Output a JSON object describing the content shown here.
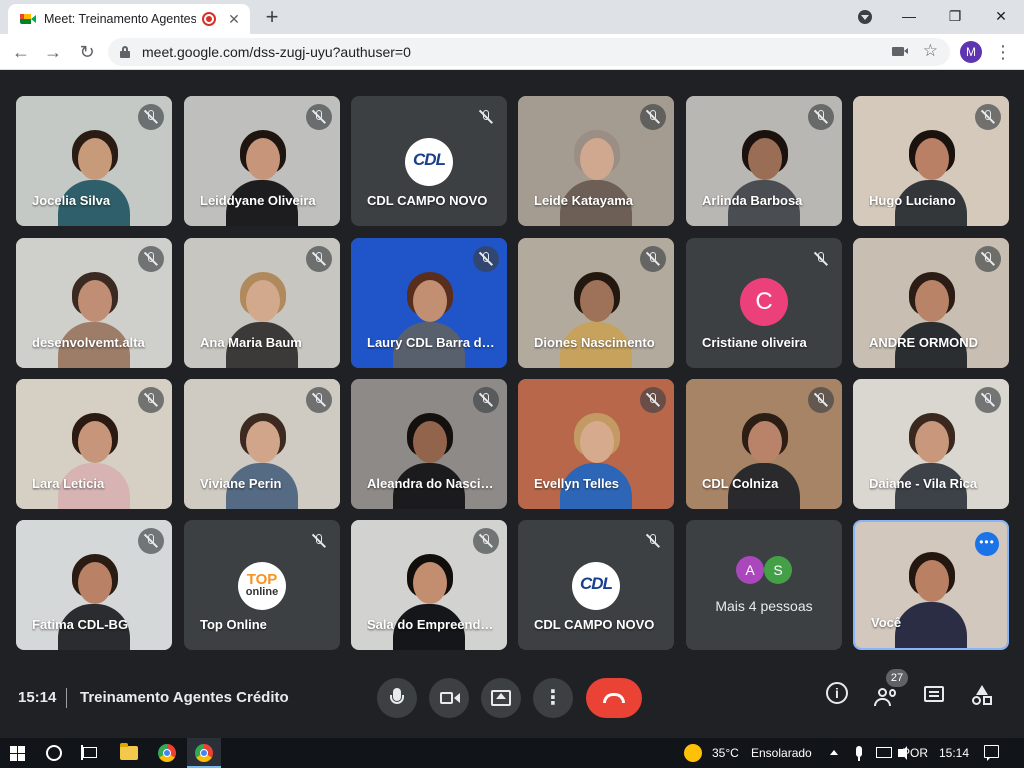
{
  "browser": {
    "tab_title": "Meet: Treinamento Agentes Crédito",
    "tab_close": "✕",
    "new_tab": "+",
    "minimize": "—",
    "maximize": "❐",
    "close": "✕",
    "back": "←",
    "forward": "→",
    "reload": "↻",
    "url": "meet.google.com/dss-zugj-uyu?authuser=0",
    "star": "☆",
    "profile_initial": "M",
    "menu": "⋮"
  },
  "tiles": [
    {
      "name": "Jocelia Silva",
      "kind": "video",
      "skin": "#c79a7a",
      "hair": "#2a1c14",
      "shirt": "#2e5f6a",
      "bg": "#c4c9c6"
    },
    {
      "name": "Leiddyane Oliveira",
      "kind": "video",
      "skin": "#c7957a",
      "hair": "#1e1410",
      "shirt": "#1d1d1f",
      "bg": "#bfc0bd"
    },
    {
      "name": "CDL CAMPO NOVO",
      "kind": "logo-cdl",
      "logo_text": "CDL"
    },
    {
      "name": "Leide Katayama",
      "kind": "video",
      "skin": "#d0a88f",
      "hair": "#9b8e84",
      "shirt": "#6d5f56",
      "bg": "#a49c90"
    },
    {
      "name": "Arlinda Barbosa",
      "kind": "video",
      "skin": "#9a6e55",
      "hair": "#1b120e",
      "shirt": "#4a4e52",
      "bg": "#b9b7b3"
    },
    {
      "name": "Hugo Luciano",
      "kind": "video",
      "skin": "#b98066",
      "hair": "#1a120d",
      "shirt": "#33373a",
      "bg": "#d4c9bb"
    },
    {
      "name": "desenvolvemt.alta",
      "kind": "video",
      "skin": "#c08e74",
      "hair": "#3a2a22",
      "shirt": "#9d7c68",
      "bg": "#cfd0cb"
    },
    {
      "name": "Ana Maria Baum",
      "kind": "video",
      "skin": "#d2a98c",
      "hair": "#b08a5c",
      "shirt": "#3c3a38",
      "bg": "#c8c6c0"
    },
    {
      "name": "Laury CDL Barra do Bugres",
      "kind": "video",
      "skin": "#c38f72",
      "hair": "#5a2e1c",
      "shirt": "#58606e",
      "bg": "#1f55c9"
    },
    {
      "name": "Diones Nascimento",
      "kind": "video",
      "skin": "#9e7258",
      "hair": "#23180f",
      "shirt": "#c7a25d",
      "bg": "#b3aa9e"
    },
    {
      "name": "Cristiane oliveira",
      "kind": "avatar",
      "initial": "C"
    },
    {
      "name": "ANDRE ORMOND",
      "kind": "video",
      "skin": "#b88366",
      "hair": "#2b1d15",
      "shirt": "#2b2e31",
      "bg": "#c8bfb2"
    },
    {
      "name": "Lara Leticia",
      "kind": "video",
      "skin": "#c7957a",
      "hair": "#2b1a12",
      "shirt": "#d7b4b3",
      "bg": "#d6d0c4"
    },
    {
      "name": "Viviane Perin",
      "kind": "video",
      "skin": "#d1a58a",
      "hair": "#3c2a20",
      "shirt": "#556a83",
      "bg": "#cfcbc3"
    },
    {
      "name": "Aleandra do Nascimento",
      "kind": "video",
      "skin": "#93644c",
      "hair": "#14100d",
      "shirt": "#1b1b1d",
      "bg": "#8d8a87"
    },
    {
      "name": "Evellyn Telles",
      "kind": "video",
      "skin": "#d6ab8d",
      "hair": "#c49a64",
      "shirt": "#2d66b6",
      "bg": "#b9674a"
    },
    {
      "name": "CDL Colniza",
      "kind": "video",
      "skin": "#b9836a",
      "hair": "#2c1d15",
      "shirt": "#2a2a2c",
      "bg": "#a88467"
    },
    {
      "name": "Daiane - Vila Rica",
      "kind": "video",
      "skin": "#c9977c",
      "hair": "#3a271d",
      "shirt": "#3d4248",
      "bg": "#d9d7d0"
    },
    {
      "name": "Fatima CDL-BG",
      "kind": "video",
      "skin": "#b98266",
      "hair": "#2a1b13",
      "shirt": "#2a2c2f",
      "bg": "#d5d8d9"
    },
    {
      "name": "Top Online",
      "kind": "logo-top",
      "logo_line1": "TOP",
      "logo_line2": "online"
    },
    {
      "name": "Sala do Empreendedor",
      "kind": "video",
      "skin": "#c38d70",
      "hair": "#120e0b",
      "shirt": "#15161a",
      "bg": "#d2d3d1"
    },
    {
      "name": "CDL CAMPO NOVO",
      "kind": "logo-cdl",
      "logo_text": "CDL"
    },
    {
      "name": "Mais 4 pessoas",
      "kind": "more",
      "initials": [
        "A",
        "S"
      ],
      "colors": [
        "#ab47bc",
        "#43a047"
      ]
    },
    {
      "name": "Você",
      "kind": "self",
      "skin": "#b98064",
      "hair": "#231710",
      "shirt": "#2b2d44",
      "bg": "#d3c8bd"
    }
  ],
  "meeting": {
    "time": "15:14",
    "title": "Treinamento Agentes Crédito",
    "participants": "27",
    "more_menu": "•••",
    "controls_more": "⋮"
  },
  "taskbar": {
    "temperature": "35°C",
    "weather": "Ensolarado",
    "language": "POR",
    "clock": "15:14"
  },
  "colors": {
    "meet_bg": "#202124",
    "tile_bg": "#3c4043",
    "hangup": "#ea4335",
    "self_border": "#8ab4f8"
  }
}
